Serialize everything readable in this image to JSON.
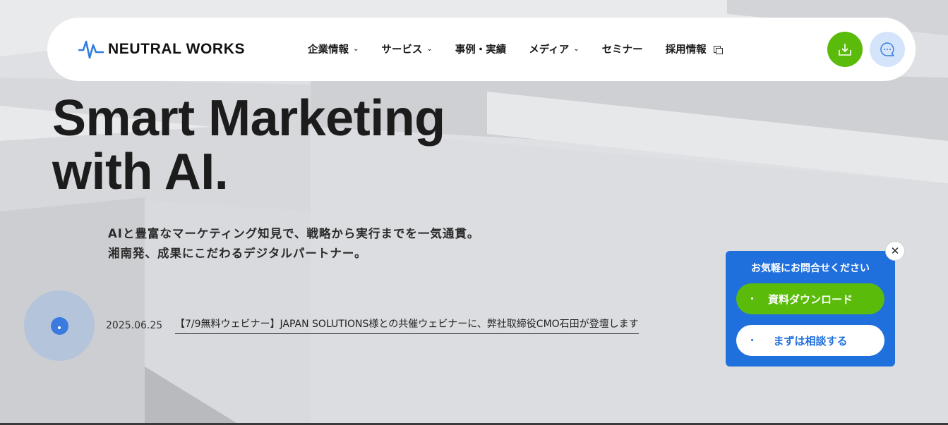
{
  "header": {
    "logo_text": "NEUTRAL WORKS",
    "nav": [
      {
        "label": "企業情報",
        "icon": "chevron-down-icon"
      },
      {
        "label": "サービス",
        "icon": "chevron-down-icon"
      },
      {
        "label": "事例・実績"
      },
      {
        "label": "メディア",
        "icon": "chevron-down-icon"
      },
      {
        "label": "セミナー"
      },
      {
        "label": "採用情報",
        "icon": "external-link-icon"
      }
    ],
    "download_icon": "download-icon",
    "chat_icon": "chat-icon"
  },
  "hero": {
    "title_line1": "Smart Marketing",
    "title_line2": "with AI.",
    "subtitle_line1": "AIと豊富なマーケティング知見で、戦略から実行までを一気通貫。",
    "subtitle_line2": "湘南発、成果にこだわるデジタルパートナー。"
  },
  "news": {
    "date": "2025.06.25",
    "title": "【7/9無料ウェビナー】JAPAN SOLUTIONS様との共催ウェビナーに、弊社取締役CMO石田が登壇します"
  },
  "contact_panel": {
    "title": "お気軽にお問合せください",
    "docs_button": "資料ダウンロード",
    "consult_button": "まずは相談する",
    "close_symbol": "✕"
  },
  "colors": {
    "accent_green": "#5bbb0b",
    "accent_blue": "#1f6fdc",
    "chat_bg": "#d4e5fb",
    "logo_blue": "#2f7de1"
  }
}
